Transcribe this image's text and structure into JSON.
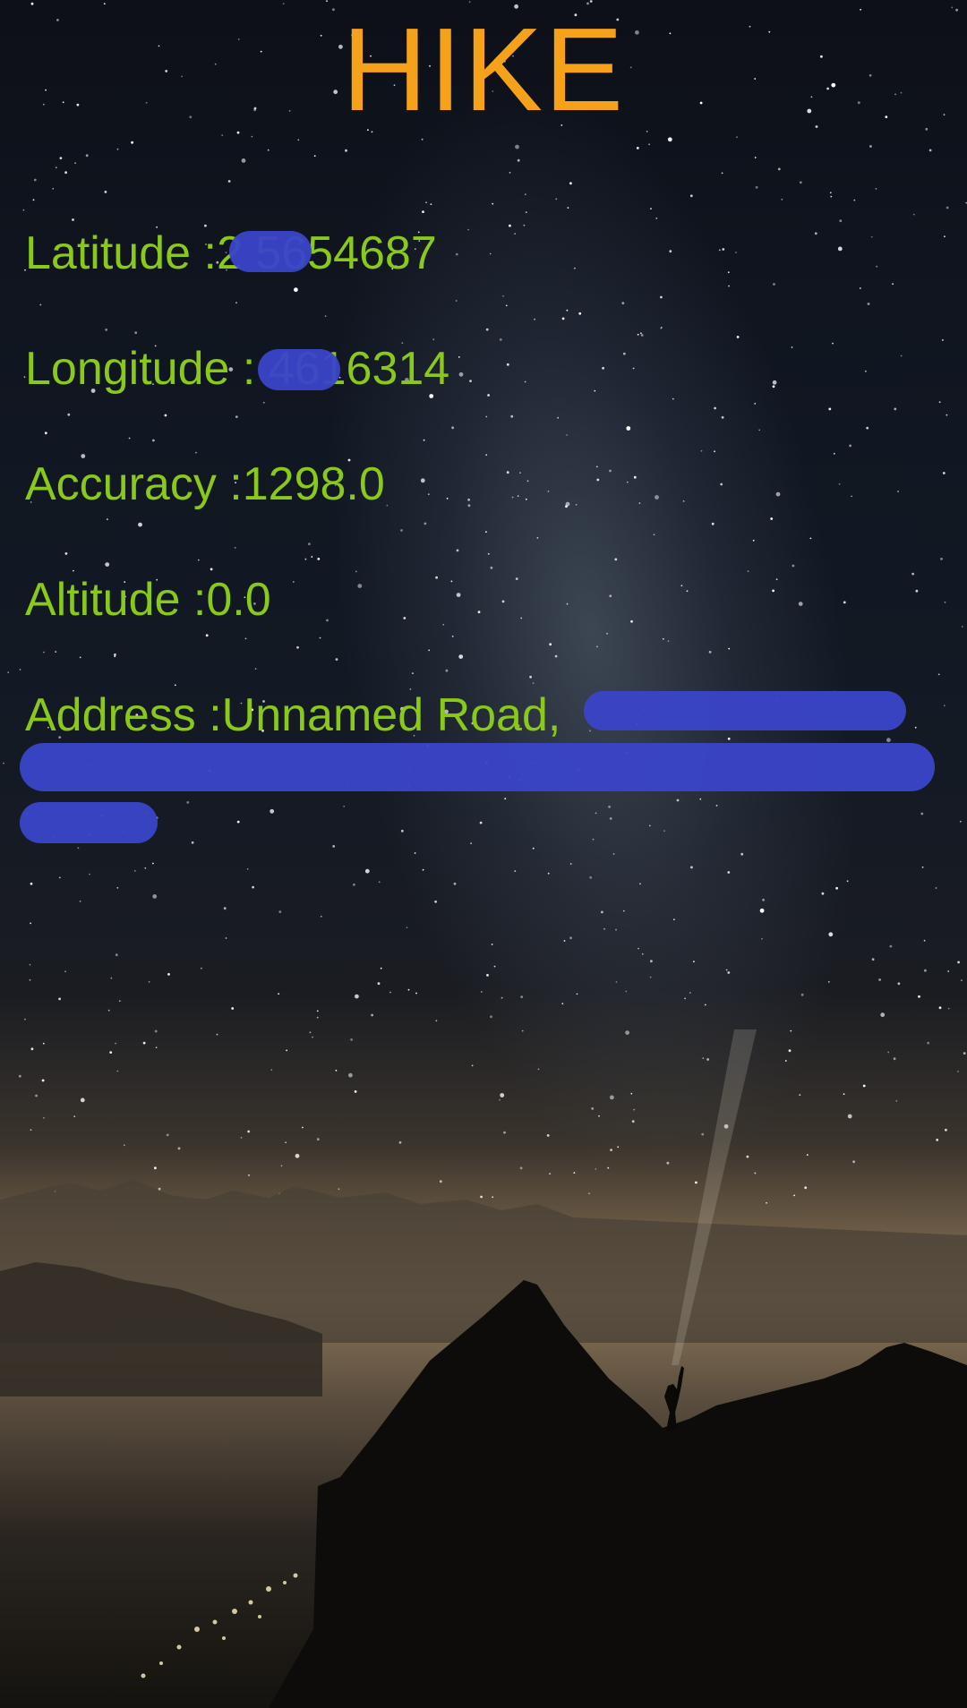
{
  "app": {
    "title": "HIKE",
    "title_color": "#f5a21a",
    "text_color": "#8ac81a"
  },
  "location": {
    "latitude_text": "Latitude :2 5654687",
    "longitude_text": "Longitude : 4616314",
    "accuracy_text": "Accuracy :1298.0",
    "altitude_text": "Altitude :0.0",
    "address_text": "Address :Unnamed Road,"
  },
  "redaction_color": "#3a45c8",
  "background": "night-sky-mountain-hiker-image"
}
